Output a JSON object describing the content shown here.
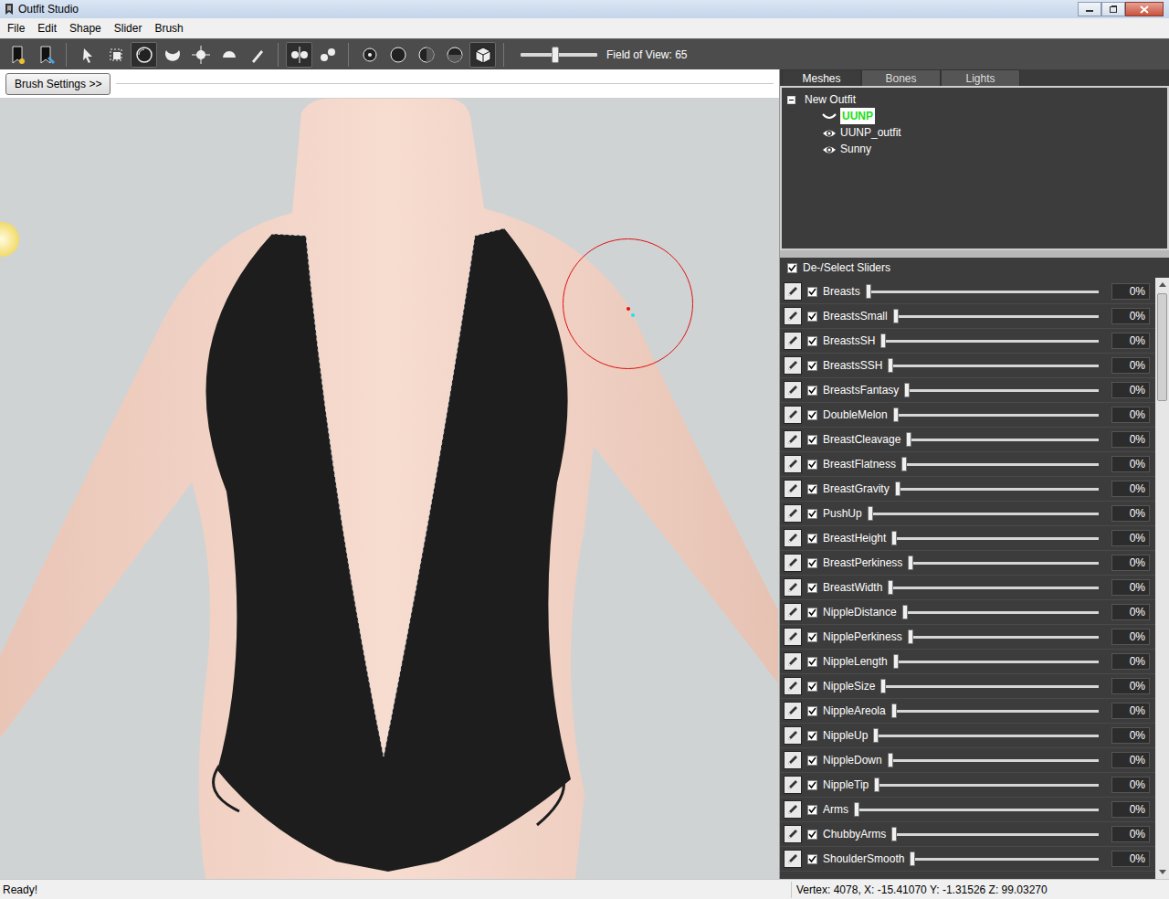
{
  "window": {
    "title": "Outfit Studio"
  },
  "menu": [
    "File",
    "Edit",
    "Shape",
    "Slider",
    "Brush"
  ],
  "tool_groups": [
    [
      {
        "kind": "new-reference",
        "selected": false
      },
      {
        "kind": "load-outfit",
        "selected": false
      }
    ],
    [
      {
        "kind": "select",
        "selected": false
      },
      {
        "kind": "mask",
        "selected": false
      },
      {
        "kind": "inflate",
        "selected": true
      },
      {
        "kind": "deflate",
        "selected": false
      },
      {
        "kind": "move",
        "selected": false
      },
      {
        "kind": "smooth",
        "selected": false
      },
      {
        "kind": "weight",
        "selected": false
      }
    ],
    [
      {
        "kind": "mirror",
        "selected": true
      },
      {
        "kind": "connected",
        "selected": false
      }
    ],
    [
      {
        "kind": "size-1",
        "selected": false
      },
      {
        "kind": "size-2",
        "selected": false
      },
      {
        "kind": "size-3",
        "selected": false
      },
      {
        "kind": "size-4",
        "selected": false
      },
      {
        "kind": "cube",
        "selected": true
      }
    ]
  ],
  "fov": {
    "label": "Field of View: 65",
    "level": 0.45
  },
  "brush_settings": "Brush Settings >>",
  "tabs": [
    {
      "label": "Meshes",
      "selected": true
    },
    {
      "label": "Bones",
      "selected": false
    },
    {
      "label": "Lights",
      "selected": false
    }
  ],
  "tree": {
    "label": "New Outfit",
    "expanded": true,
    "children": [
      {
        "label": "UUNP",
        "visible": false,
        "selected": true
      },
      {
        "label": "UUNP_outfit",
        "visible": true,
        "selected": false
      },
      {
        "label": "Sunny",
        "visible": true,
        "selected": false
      }
    ]
  },
  "slider_header": {
    "label": "De-/Select Sliders",
    "checked": true
  },
  "sliders": [
    {
      "name": "Breasts",
      "checked": true,
      "level": 0,
      "reading": "0%"
    },
    {
      "name": "BreastsSmall",
      "checked": true,
      "level": 0,
      "reading": "0%"
    },
    {
      "name": "BreastsSH",
      "checked": true,
      "level": 0,
      "reading": "0%"
    },
    {
      "name": "BreastsSSH",
      "checked": true,
      "level": 0,
      "reading": "0%"
    },
    {
      "name": "BreastsFantasy",
      "checked": true,
      "level": 0,
      "reading": "0%"
    },
    {
      "name": "DoubleMelon",
      "checked": true,
      "level": 0,
      "reading": "0%"
    },
    {
      "name": "BreastCleavage",
      "checked": true,
      "level": 0,
      "reading": "0%"
    },
    {
      "name": "BreastFlatness",
      "checked": true,
      "level": 0,
      "reading": "0%"
    },
    {
      "name": "BreastGravity",
      "checked": true,
      "level": 0,
      "reading": "0%"
    },
    {
      "name": "PushUp",
      "checked": true,
      "level": 0,
      "reading": "0%"
    },
    {
      "name": "BreastHeight",
      "checked": true,
      "level": 0,
      "reading": "0%"
    },
    {
      "name": "BreastPerkiness",
      "checked": true,
      "level": 0,
      "reading": "0%"
    },
    {
      "name": "BreastWidth",
      "checked": true,
      "level": 0,
      "reading": "0%"
    },
    {
      "name": "NippleDistance",
      "checked": true,
      "level": 0,
      "reading": "0%"
    },
    {
      "name": "NipplePerkiness",
      "checked": true,
      "level": 0,
      "reading": "0%"
    },
    {
      "name": "NippleLength",
      "checked": true,
      "level": 0,
      "reading": "0%"
    },
    {
      "name": "NippleSize",
      "checked": true,
      "level": 0,
      "reading": "0%"
    },
    {
      "name": "NippleAreola",
      "checked": true,
      "level": 0,
      "reading": "0%"
    },
    {
      "name": "NippleUp",
      "checked": true,
      "level": 0,
      "reading": "0%"
    },
    {
      "name": "NippleDown",
      "checked": true,
      "level": 0,
      "reading": "0%"
    },
    {
      "name": "NippleTip",
      "checked": true,
      "level": 0,
      "reading": "0%"
    },
    {
      "name": "Arms",
      "checked": true,
      "level": 0,
      "reading": "0%"
    },
    {
      "name": "ChubbyArms",
      "checked": true,
      "level": 0,
      "reading": "0%"
    },
    {
      "name": "ShoulderSmooth",
      "checked": true,
      "level": 0,
      "reading": "0%"
    }
  ],
  "status_bar": {
    "left": "Ready!",
    "right": "Vertex: 4078, X: -15.41070 Y: -1.31526 Z: 99.03270"
  }
}
